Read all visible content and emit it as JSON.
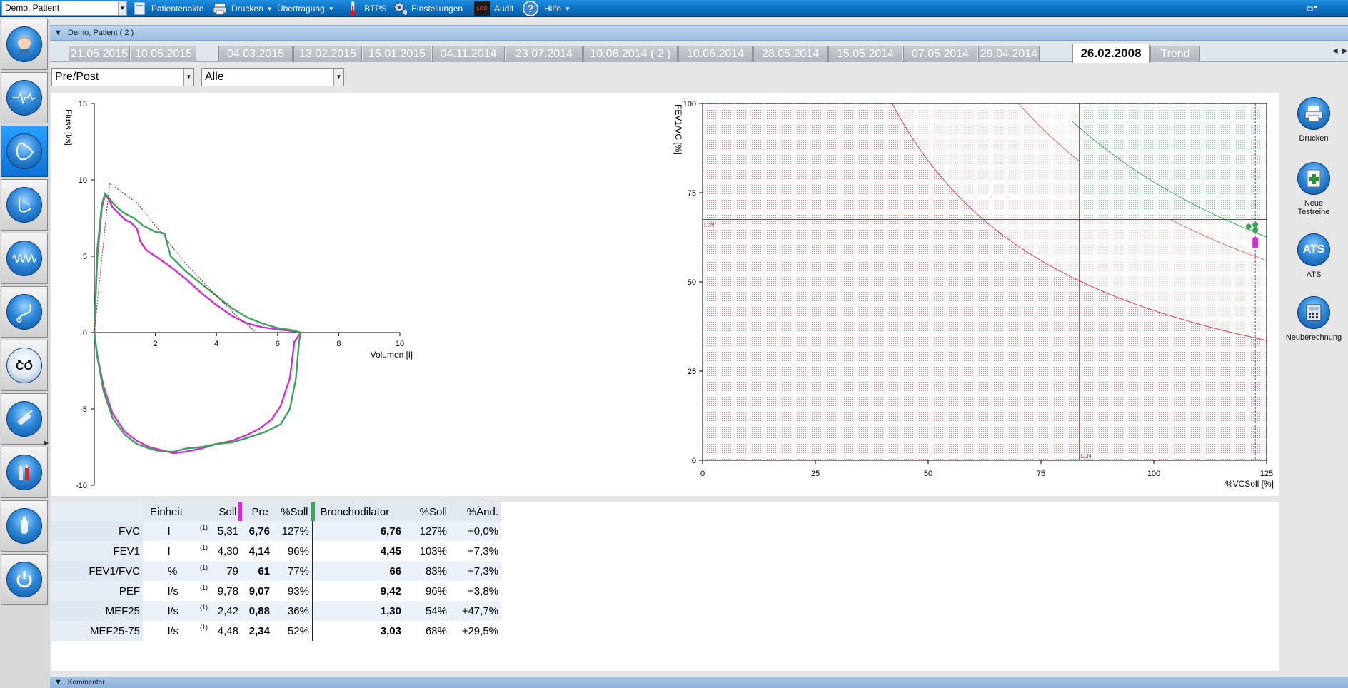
{
  "toolbar": {
    "patient": "Demo, Patient",
    "items": [
      "Patientenakte",
      "Drucken",
      "Übertragung",
      "BTPS",
      "Einstellungen",
      "Audit",
      "Hilfe"
    ],
    "audit_logo": "LOG"
  },
  "header": {
    "title": "Demo, Patient ( 2 )"
  },
  "tabs": [
    "21.05.2015",
    "10.05.2015",
    "04.03.2015",
    "13.02.2015",
    "15.01.2015",
    "04.11.2014",
    "23.07.2014",
    "10.06.2014 ( 2 )",
    "10.06.2014",
    "28.05.2014",
    "15.05.2014",
    "07.05.2014",
    "29.04.2014",
    "26.02.2008",
    "Trend"
  ],
  "active_tab": "26.02.2008",
  "filters": {
    "mode": "Pre/Post",
    "scope": "Alle"
  },
  "sidebar": {
    "icons": [
      "face-icon",
      "waveform-icon",
      "flow-volume-icon",
      "lung-hand-icon",
      "oscillation-icon",
      "stethoscope-icon",
      "co-icon",
      "syringe-icon",
      "bottles-icon",
      "gas-bottle-icon",
      "power-icon"
    ]
  },
  "actions": [
    {
      "label": "Drucken",
      "icon": "printer-icon"
    },
    {
      "label": "Neue Testreihe",
      "icon": "new-series-icon"
    },
    {
      "label": "ATS",
      "icon": "ats-icon",
      "text": "ATS"
    },
    {
      "label": "Neuberechnung",
      "icon": "calculator-icon"
    }
  ],
  "chart_data": [
    {
      "type": "line",
      "xlabel": "Volumen [l]",
      "ylabel": "Fluss [l/s]",
      "xlim": [
        0,
        10
      ],
      "ylim": [
        -10,
        15
      ],
      "xticks": [
        2,
        4,
        6,
        8,
        10
      ],
      "yticks": [
        15,
        10,
        5,
        0,
        -5,
        -10
      ],
      "series": [
        {
          "color": "#d22fd2",
          "style": "solid",
          "points": [
            [
              0,
              0
            ],
            [
              0.1,
              5
            ],
            [
              0.25,
              8.2
            ],
            [
              0.35,
              9.0
            ],
            [
              0.45,
              8.8
            ],
            [
              0.6,
              8.2
            ],
            [
              0.8,
              7.8
            ],
            [
              1.0,
              7.4
            ],
            [
              1.2,
              7.2
            ],
            [
              1.4,
              6.8
            ],
            [
              1.5,
              6.0
            ],
            [
              1.7,
              5.4
            ],
            [
              2.0,
              5.0
            ],
            [
              2.5,
              4.3
            ],
            [
              3.0,
              3.5
            ],
            [
              3.5,
              2.6
            ],
            [
              4.0,
              1.8
            ],
            [
              4.5,
              1.1
            ],
            [
              5.0,
              0.6
            ],
            [
              5.5,
              0.35
            ],
            [
              6.0,
              0.2
            ],
            [
              6.5,
              0.1
            ],
            [
              6.76,
              0
            ],
            [
              6.55,
              -0.6
            ],
            [
              6.4,
              -3.0
            ],
            [
              6.1,
              -4.8
            ],
            [
              5.8,
              -5.7
            ],
            [
              5.4,
              -6.3
            ],
            [
              5.0,
              -6.7
            ],
            [
              4.5,
              -7.1
            ],
            [
              4.0,
              -7.3
            ],
            [
              3.5,
              -7.6
            ],
            [
              3.0,
              -7.8
            ],
            [
              2.6,
              -7.9
            ],
            [
              2.2,
              -7.7
            ],
            [
              1.8,
              -7.5
            ],
            [
              1.4,
              -7.1
            ],
            [
              1.0,
              -6.5
            ],
            [
              0.6,
              -5.3
            ],
            [
              0.3,
              -3.5
            ],
            [
              0.1,
              -1.5
            ],
            [
              0,
              0
            ]
          ]
        },
        {
          "color": "#3ea35a",
          "style": "solid",
          "points": [
            [
              0,
              0
            ],
            [
              0.1,
              5.5
            ],
            [
              0.25,
              8.4
            ],
            [
              0.35,
              9.1
            ],
            [
              0.45,
              8.9
            ],
            [
              0.6,
              8.5
            ],
            [
              0.8,
              8.1
            ],
            [
              1.0,
              7.8
            ],
            [
              1.3,
              7.5
            ],
            [
              1.6,
              7.0
            ],
            [
              2.0,
              6.6
            ],
            [
              2.3,
              6.5
            ],
            [
              2.5,
              5.0
            ],
            [
              3.0,
              4.0
            ],
            [
              3.5,
              3.2
            ],
            [
              4.0,
              2.4
            ],
            [
              4.5,
              1.6
            ],
            [
              5.0,
              1.0
            ],
            [
              5.5,
              0.6
            ],
            [
              6.0,
              0.3
            ],
            [
              6.5,
              0.15
            ],
            [
              6.76,
              0
            ],
            [
              6.7,
              -0.6
            ],
            [
              6.6,
              -3.0
            ],
            [
              6.4,
              -5.0
            ],
            [
              6.1,
              -6.0
            ],
            [
              5.6,
              -6.5
            ],
            [
              5.0,
              -6.9
            ],
            [
              4.5,
              -7.2
            ],
            [
              4.0,
              -7.3
            ],
            [
              3.5,
              -7.5
            ],
            [
              3.0,
              -7.6
            ],
            [
              2.6,
              -7.8
            ],
            [
              2.2,
              -7.8
            ],
            [
              1.8,
              -7.6
            ],
            [
              1.4,
              -7.3
            ],
            [
              1.0,
              -6.7
            ],
            [
              0.6,
              -5.6
            ],
            [
              0.3,
              -3.8
            ],
            [
              0.1,
              -1.6
            ],
            [
              0,
              0
            ]
          ]
        },
        {
          "color": "#8b1a1a",
          "style": "dashed",
          "points": [
            [
              0,
              0
            ],
            [
              0.5,
              9.78
            ],
            [
              1.4,
              8.5
            ],
            [
              2.0,
              7.0
            ],
            [
              3.0,
              4.5
            ],
            [
              4.0,
              2.4
            ],
            [
              4.6,
              1.2
            ],
            [
              5.31,
              0
            ]
          ]
        }
      ]
    },
    {
      "type": "scatter",
      "xlabel": "%VCSoll [%]",
      "ylabel": "FEV1/VC [%]",
      "xlim": [
        0,
        125
      ],
      "ylim": [
        0,
        100
      ],
      "xticks": [
        0,
        25,
        50,
        75,
        100,
        125
      ],
      "yticks": [
        0,
        25,
        50,
        75,
        100
      ],
      "lln_fev1vc": 67.5,
      "lln_vc": 83.5,
      "lln_label": "LLN",
      "points": [
        {
          "x": 121,
          "y": 65.5,
          "color": "#3ea35a"
        },
        {
          "x": 122.5,
          "y": 66,
          "color": "#3ea35a"
        },
        {
          "x": 122.5,
          "y": 64.5,
          "color": "#3ea35a"
        },
        {
          "x": 122.5,
          "y": 61.5,
          "color": "#d22fd2"
        },
        {
          "x": 122.5,
          "y": 60.5,
          "color": "#d22fd2"
        }
      ],
      "vertical_line_x": 122.5
    }
  ],
  "table": {
    "headers": {
      "unit": "Einheit",
      "soll": "Soll",
      "pre": "Pre",
      "psoll": "%Soll",
      "bd": "Bronchodilator",
      "bsoll": "%Soll",
      "change": "%Änd."
    },
    "rows": [
      {
        "name": "FVC",
        "unit": "l",
        "sup": "(1)",
        "soll": "5,31",
        "pre": "6,76",
        "psoll": "127%",
        "bd": "6,76",
        "bsoll": "127%",
        "change": "+0,0%"
      },
      {
        "name": "FEV1",
        "unit": "l",
        "sup": "(1)",
        "soll": "4,30",
        "pre": "4,14",
        "psoll": "96%",
        "bd": "4,45",
        "bsoll": "103%",
        "change": "+7,3%"
      },
      {
        "name": "FEV1/FVC",
        "unit": "%",
        "sup": "(1)",
        "soll": "79",
        "pre": "61",
        "psoll": "77%",
        "bd": "66",
        "bsoll": "83%",
        "change": "+7,3%"
      },
      {
        "name": "PEF",
        "unit": "l/s",
        "sup": "(1)",
        "soll": "9,78",
        "pre": "9,07",
        "psoll": "93%",
        "bd": "9,42",
        "bsoll": "96%",
        "change": "+3,8%"
      },
      {
        "name": "MEF25",
        "unit": "l/s",
        "sup": "(1)",
        "soll": "2,42",
        "pre": "0,88",
        "psoll": "36%",
        "bd": "1,30",
        "bsoll": "54%",
        "change": "+47,7%"
      },
      {
        "name": "MEF25-75",
        "unit": "l/s",
        "sup": "(1)",
        "soll": "4,48",
        "pre": "2,34",
        "psoll": "52%",
        "bd": "3,03",
        "bsoll": "68%",
        "change": "+29,5%"
      }
    ]
  },
  "footer": {
    "title": "Kommentar"
  },
  "colors": {
    "pre": "#d22fd2",
    "post": "#3ea35a",
    "predicted": "#8b1a1a",
    "accent": "#0e6fc2"
  }
}
